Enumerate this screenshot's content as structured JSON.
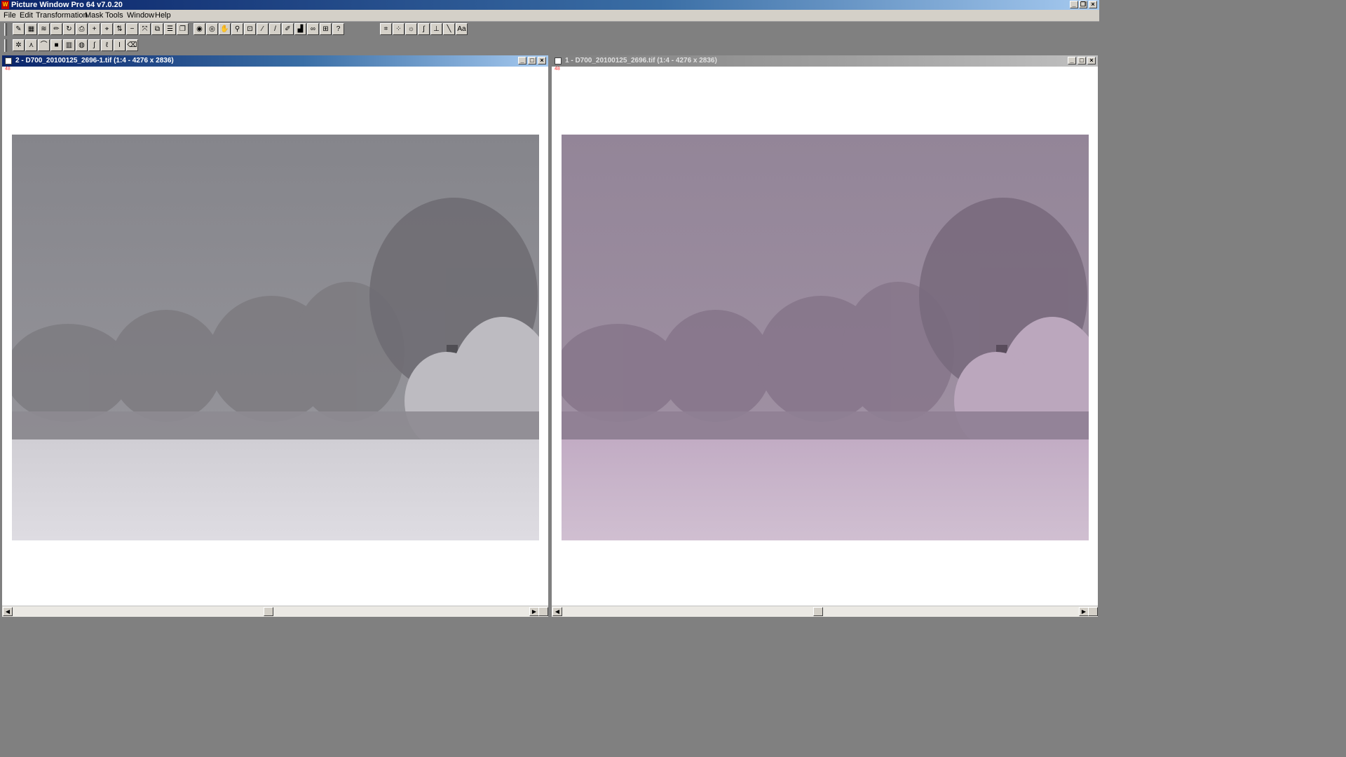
{
  "app": {
    "title": "Picture Window Pro 64  v7.0.20",
    "icon": "app-logo-icon",
    "window_buttons": [
      "minimize-icon",
      "restore-icon",
      "close-icon"
    ]
  },
  "menu": [
    "File",
    "Edit",
    "Transformation",
    "Mask",
    "Tools",
    "Window",
    "Help"
  ],
  "toolbar_row1_group1": [
    {
      "icon": "brush-icon",
      "glyph": "✎"
    },
    {
      "icon": "grid-icon",
      "glyph": "▦"
    },
    {
      "icon": "wave-icon",
      "glyph": "≋"
    },
    {
      "icon": "pencil-icon",
      "glyph": "✏"
    },
    {
      "icon": "rotate-icon",
      "glyph": "↻"
    },
    {
      "icon": "print-icon",
      "glyph": "⎙"
    },
    {
      "icon": "plus-icon",
      "glyph": "+"
    },
    {
      "icon": "target-icon",
      "glyph": "⌖"
    },
    {
      "icon": "align-icon",
      "glyph": "⇅"
    },
    {
      "icon": "minus-icon",
      "glyph": "−"
    },
    {
      "icon": "expand-icon",
      "glyph": "⤧"
    },
    {
      "icon": "compose-icon",
      "glyph": "⧉"
    },
    {
      "icon": "list-icon",
      "glyph": "☰"
    },
    {
      "icon": "copy-icon",
      "glyph": "❐"
    }
  ],
  "toolbar_row1_group2": [
    {
      "icon": "camera-icon",
      "glyph": "◉"
    },
    {
      "icon": "circle-icon",
      "glyph": "◎"
    },
    {
      "icon": "hand-icon",
      "glyph": "✋"
    },
    {
      "icon": "zoom-icon",
      "glyph": "⚲"
    },
    {
      "icon": "clone-icon",
      "glyph": "⊡"
    },
    {
      "icon": "feather-icon",
      "glyph": "⁄"
    },
    {
      "icon": "line-brush-icon",
      "glyph": "/"
    },
    {
      "icon": "paint-brush-icon",
      "glyph": "✐"
    },
    {
      "icon": "histogram-icon",
      "glyph": "▟"
    },
    {
      "icon": "lasso-icon",
      "glyph": "∞"
    },
    {
      "icon": "stamp-icon",
      "glyph": "⊞"
    },
    {
      "icon": "help-icon",
      "glyph": "?"
    }
  ],
  "toolbar_row1_group3": [
    {
      "icon": "crop-icon",
      "glyph": "⌗"
    },
    {
      "icon": "select-points-icon",
      "glyph": "⁘"
    },
    {
      "icon": "brightness-icon",
      "glyph": "☼"
    },
    {
      "icon": "curve-icon",
      "glyph": "∫"
    },
    {
      "icon": "level-icon",
      "glyph": "⊥"
    },
    {
      "icon": "diagonal-line-icon",
      "glyph": "╲"
    },
    {
      "icon": "text-icon",
      "glyph": "Aa"
    }
  ],
  "toolbar_row2": [
    {
      "icon": "sparkle-icon",
      "glyph": "✲"
    },
    {
      "icon": "sharpen-icon",
      "glyph": "⋏"
    },
    {
      "icon": "soften-icon",
      "glyph": "⌒"
    },
    {
      "icon": "black-fill-icon",
      "glyph": "■"
    },
    {
      "icon": "gradient-icon",
      "glyph": "▥"
    },
    {
      "icon": "vignette-icon",
      "glyph": "◍"
    },
    {
      "icon": "curves-icon",
      "glyph": "∫"
    },
    {
      "icon": "dropper-icon",
      "glyph": "ℓ"
    },
    {
      "icon": "text-cursor-icon",
      "glyph": "I"
    },
    {
      "icon": "eraser-icon",
      "glyph": "⌫"
    }
  ],
  "windows": [
    {
      "title": "2 - D700_20100125_2696-1.tif (1:4 - 4276 x 2836)",
      "state": "active",
      "corner_number": "48",
      "tint": "neutral-gray"
    },
    {
      "title": "1 - D700_20100125_2696.tif (1:4 - 4276 x 2836)",
      "state": "inactive",
      "corner_number": "48",
      "tint": "magenta-cast"
    }
  ],
  "colors": {
    "title_active_start": "#0a246a",
    "title_active_end": "#a6caf0",
    "title_inactive": "#a0a0a0",
    "workspace": "#808080",
    "sky_left": "#8a8a90",
    "sky_right": "#968799",
    "snow_left": "#d6d4da",
    "snow_right": "#c8b2c8"
  }
}
